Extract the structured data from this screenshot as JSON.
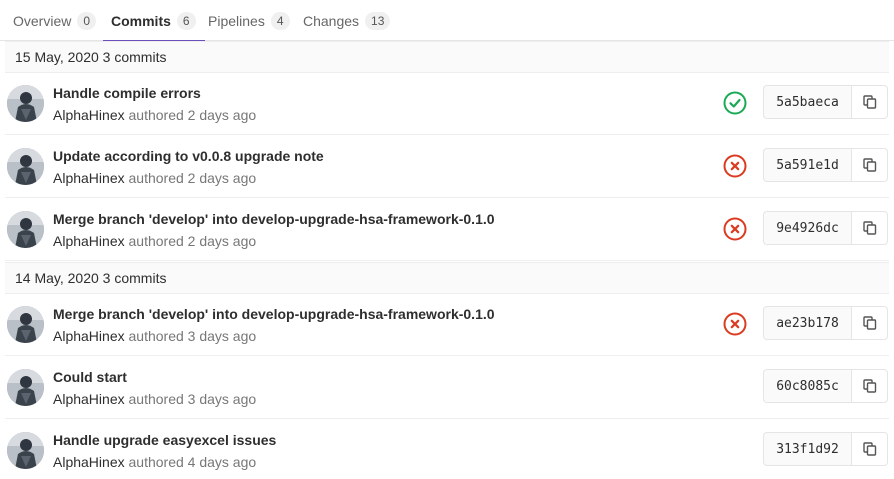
{
  "tabs": [
    {
      "label": "Overview",
      "count": "0"
    },
    {
      "label": "Commits",
      "count": "6"
    },
    {
      "label": "Pipelines",
      "count": "4"
    },
    {
      "label": "Changes",
      "count": "13"
    }
  ],
  "groups": [
    {
      "header": "15 May, 2020 3 commits"
    },
    {
      "header": "14 May, 2020 3 commits"
    }
  ],
  "commits": [
    {
      "title": "Handle compile errors",
      "author": "AlphaHinex",
      "meta": " authored 2 days ago",
      "sha": "5a5baeca",
      "status": "success"
    },
    {
      "title": "Update according to v0.0.8 upgrade note",
      "author": "AlphaHinex",
      "meta": " authored 2 days ago",
      "sha": "5a591e1d",
      "status": "failed"
    },
    {
      "title": "Merge branch 'develop' into develop-upgrade-hsa-framework-0.1.0",
      "author": "AlphaHinex",
      "meta": " authored 2 days ago",
      "sha": "9e4926dc",
      "status": "failed"
    },
    {
      "title": "Merge branch 'develop' into develop-upgrade-hsa-framework-0.1.0",
      "author": "AlphaHinex",
      "meta": " authored 3 days ago",
      "sha": "ae23b178",
      "status": "failed"
    },
    {
      "title": "Could start",
      "author": "AlphaHinex",
      "meta": " authored 3 days ago",
      "sha": "60c8085c",
      "status": "none"
    },
    {
      "title": "Handle upgrade easyexcel issues",
      "author": "AlphaHinex",
      "meta": " authored 4 days ago",
      "sha": "313f1d92",
      "status": "none"
    }
  ],
  "colors": {
    "accent": "#6b4fbb",
    "success": "#1aaa55",
    "failed": "#db3b21"
  },
  "icons": {
    "success": "check-circle-icon",
    "failed": "close-circle-icon",
    "copy": "copy-icon"
  }
}
